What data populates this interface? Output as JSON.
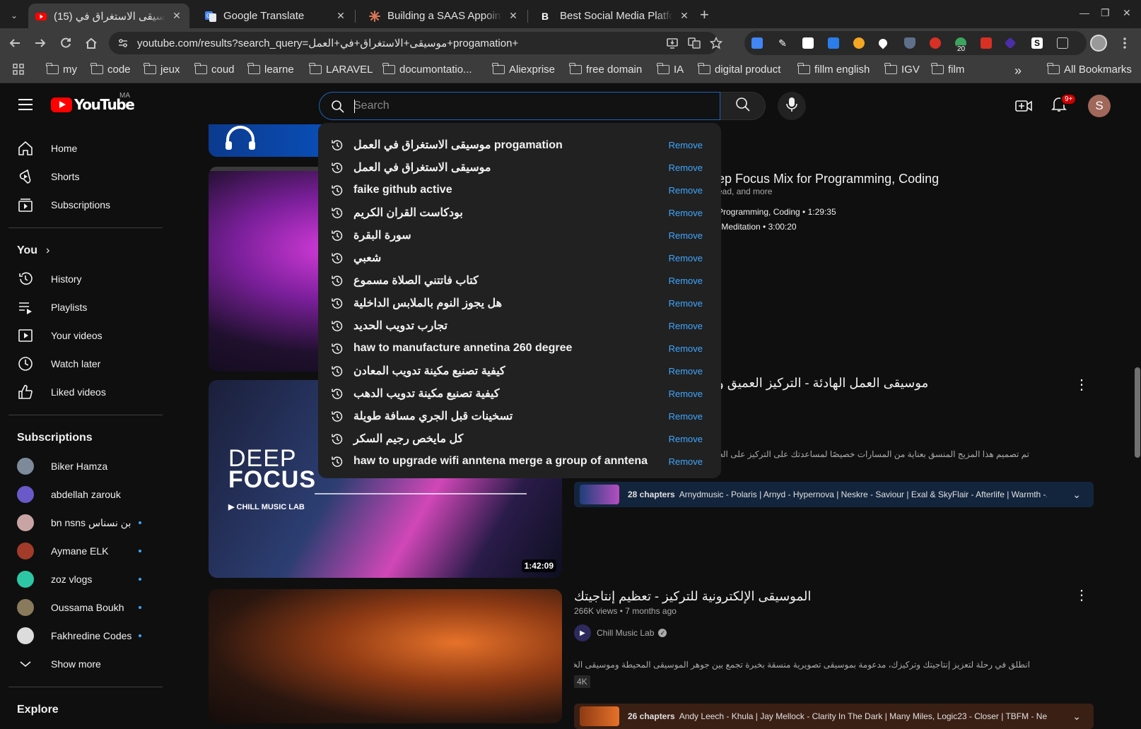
{
  "browser": {
    "tabs": [
      {
        "title": "(15) موسيقى الاستغراق في",
        "active": true
      },
      {
        "title": "Google Translate",
        "active": false
      },
      {
        "title": "Building a SAAS Appoint",
        "active": false
      },
      {
        "title": "Best Social Media Platfor",
        "active": false
      }
    ],
    "url": "youtube.com/results?search_query=موسيقى+الاستغراق+في+العمل+progamation+",
    "extension_badge": "20",
    "bookmarks": [
      "my",
      "code",
      "jeux",
      "coud",
      "learne",
      "LARAVEL",
      "documontatio...",
      "Aliexprise",
      "free domain",
      "IA",
      "digital product",
      "fillm english",
      "IGV",
      "film"
    ],
    "all_bookmarks": "All Bookmarks",
    "overflow": "»"
  },
  "youtube": {
    "logo_text": "YouTube",
    "country_code": "MA",
    "search_placeholder": "Search",
    "notification_count": "9+",
    "avatar_letter": "S",
    "sidebar": {
      "main": [
        "Home",
        "Shorts",
        "Subscriptions"
      ],
      "you_label": "You",
      "you_items": [
        "History",
        "Playlists",
        "Your videos",
        "Watch later",
        "Liked videos"
      ],
      "subscriptions_heading": "Subscriptions",
      "subscriptions": [
        {
          "name": "Biker Hamza",
          "dot": false
        },
        {
          "name": "abdellah zarouk",
          "dot": false
        },
        {
          "name": "bn nsns بن نسناس",
          "dot": true
        },
        {
          "name": "Aymane ELK",
          "dot": true
        },
        {
          "name": "zoz vlogs",
          "dot": true
        },
        {
          "name": "Oussama Boukh",
          "dot": true
        },
        {
          "name": "Fakhredine Codes",
          "dot": true
        }
      ],
      "show_more": "Show more",
      "explore_heading": "Explore"
    },
    "suggestions": [
      "موسيقى الاستغراق في العمل progamation",
      "موسيقى الاستغراق في العمل",
      "faike github active",
      "بودكاست القران الكريم",
      "سورة البقرة",
      "شعبي",
      "كتاب فاتتني الصلاة مسموع",
      "هل يجوز النوم بالملابس الداخلية",
      "تجارب تدويب الحديد",
      "haw to manufacture annetina 260 degree",
      "كيفية تصنيع مكينة تدويب المعادن",
      "كيفية تصنيع مكينة تدويب الدهب",
      "تسخينات قبل الجري مسافة طويلة",
      "كل مايخص رجيم السكر",
      "haw to upgrade wifi anntena merge a group of anntena"
    ],
    "remove_label": "Remove",
    "results": {
      "mix": {
        "title_partial": "ep Focus Mix for Programming, Coding",
        "sub_partial": "ead, and more",
        "line1": "Programming, Coding • 1:29:35",
        "line2": "‹ Meditation • 3:00:20"
      },
      "video1": {
        "title_partial": "موسيقى العمل الهادئة - التركيز العميق و",
        "desc": "تم تصميم هذا المزيج المنسق بعناية من المسارات خصيصًا لمساعدتك على التركيز على العم ...",
        "duration": "1:42:09",
        "thumb_text1": "DEEP",
        "thumb_text2": "FOCUS",
        "thumb_brand": "CHILL MUSIC LAB",
        "chapters_count": "28 chapters",
        "chapters_text": "Arnydmusic - Polaris | Arnyd - Hypernova | Neskre - Saviour | Exal & SkyFlair - Afterlife | Warmth -..."
      },
      "video2": {
        "title": "الموسيقى الإلكترونية للتركيز - تعظيم إنتاجيتك",
        "meta": "266K views • 7 months ago",
        "channel": "Chill Music Lab",
        "desc": "انطلق في رحلة لتعزيز إنتاجيتك وتركيزك، مدعومة بموسيقى تصويرية منسقة بخبرة تجمع بين جوهر الموسيقى المحيطة وموسيقى الخلفية ...",
        "badge": "4K",
        "chapters_count": "26 chapters",
        "chapters_text": "Andy Leech - Khula | Jay Mellock - Clarity In The Dark | Many Miles, Logic23 - Closer | TBFM - Need Yo..."
      }
    }
  }
}
